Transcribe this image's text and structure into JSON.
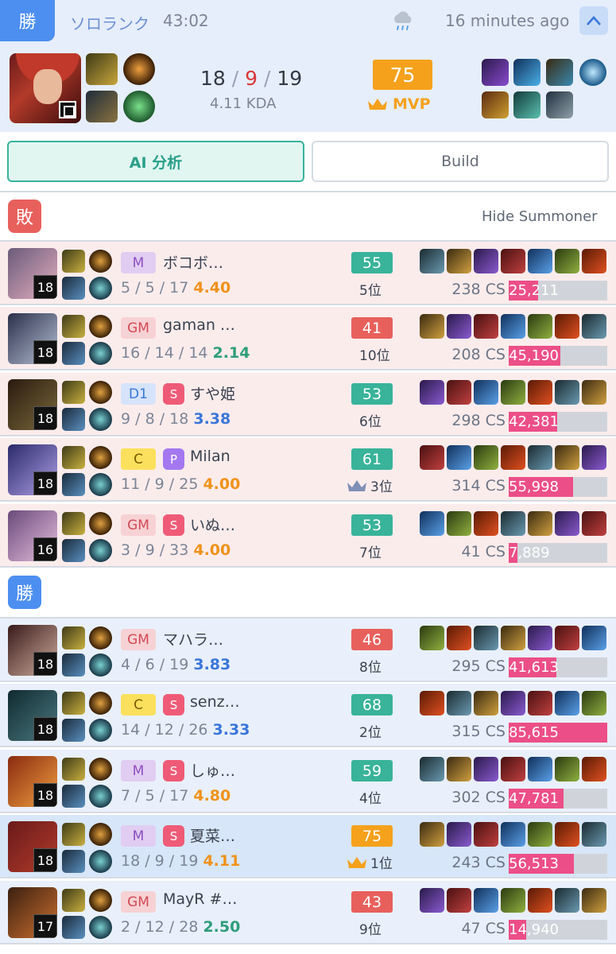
{
  "header": {
    "result": "勝",
    "queue": "ソロランク",
    "duration": "43:02",
    "time_ago": "16 minutes ago"
  },
  "summary": {
    "kills": "18",
    "deaths": "9",
    "assists": "19",
    "kda_ratio": "4.11 KDA",
    "score": "75",
    "mvp_label": "MVP"
  },
  "tabs": {
    "ai": "AI 分析",
    "build": "Build"
  },
  "teams": {
    "lose_label": "敗",
    "win_label": "勝",
    "hide_summoner": "Hide Summoner"
  },
  "colors": {
    "win": "#4d8ff0",
    "lose": "#e8605c",
    "damage": "#ec4f87",
    "score_green": "#39b39a",
    "score_red": "#e8605c",
    "mvp_orange": "#f5a11c"
  },
  "players": [
    {
      "team": "lose",
      "level": "18",
      "rank": "M",
      "sub": "",
      "name": "ボコボ…",
      "k": "5",
      "d": "5",
      "a": "17",
      "ratio": "4.40",
      "ratio_color": "or",
      "score": "55",
      "score_color": "g",
      "place": "5位",
      "crown": false,
      "cs": "238 CS",
      "damage": "25,211",
      "damage_value": 25211
    },
    {
      "team": "lose",
      "level": "18",
      "rank": "GM",
      "sub": "",
      "name": "gaman …",
      "k": "16",
      "d": "14",
      "a": "14",
      "ratio": "2.14",
      "ratio_color": "gr",
      "score": "41",
      "score_color": "r",
      "place": "10位",
      "crown": false,
      "cs": "208 CS",
      "damage": "45,190",
      "damage_value": 45190
    },
    {
      "team": "lose",
      "level": "18",
      "rank": "D1",
      "sub": "S",
      "name": "すや姫",
      "k": "9",
      "d": "8",
      "a": "18",
      "ratio": "3.38",
      "ratio_color": "bl",
      "score": "53",
      "score_color": "g",
      "place": "6位",
      "crown": false,
      "cs": "298 CS",
      "damage": "42,381",
      "damage_value": 42381
    },
    {
      "team": "lose",
      "level": "18",
      "rank": "C",
      "sub": "P",
      "name": "Milan",
      "k": "11",
      "d": "9",
      "a": "25",
      "ratio": "4.00",
      "ratio_color": "or",
      "score": "61",
      "score_color": "g",
      "place": "3位",
      "crown": true,
      "cs": "314 CS",
      "damage": "55,998",
      "damage_value": 55998
    },
    {
      "team": "lose",
      "level": "16",
      "rank": "GM",
      "sub": "S",
      "name": "いぬ…",
      "k": "3",
      "d": "9",
      "a": "33",
      "ratio": "4.00",
      "ratio_color": "or",
      "score": "53",
      "score_color": "g",
      "place": "7位",
      "crown": false,
      "cs": "41 CS",
      "damage": "7,889",
      "damage_value": 7889
    },
    {
      "team": "win",
      "level": "18",
      "rank": "GM",
      "sub": "",
      "name": "マハラ…",
      "k": "4",
      "d": "6",
      "a": "19",
      "ratio": "3.83",
      "ratio_color": "bl",
      "score": "46",
      "score_color": "r",
      "place": "8位",
      "crown": false,
      "cs": "295 CS",
      "damage": "41,613",
      "damage_value": 41613
    },
    {
      "team": "win",
      "level": "18",
      "rank": "C",
      "sub": "S",
      "name": "senz…",
      "k": "14",
      "d": "12",
      "a": "26",
      "ratio": "3.33",
      "ratio_color": "bl",
      "score": "68",
      "score_color": "g",
      "place": "2位",
      "crown": false,
      "cs": "315 CS",
      "damage": "85,615",
      "damage_value": 85615
    },
    {
      "team": "win",
      "level": "18",
      "rank": "M",
      "sub": "S",
      "name": "しゅ…",
      "k": "7",
      "d": "5",
      "a": "17",
      "ratio": "4.80",
      "ratio_color": "or",
      "score": "59",
      "score_color": "g",
      "place": "4位",
      "crown": false,
      "cs": "302 CS",
      "damage": "47,781",
      "damage_value": 47781
    },
    {
      "team": "win",
      "level": "18",
      "rank": "M",
      "sub": "S",
      "name": "夏菜…",
      "k": "18",
      "d": "9",
      "a": "19",
      "ratio": "4.11",
      "ratio_color": "or",
      "score": "75",
      "score_color": "o",
      "place": "1位",
      "crown": true,
      "cs": "243 CS",
      "damage": "56,513",
      "damage_value": 56513,
      "me": true
    },
    {
      "team": "win",
      "level": "17",
      "rank": "GM",
      "sub": "",
      "name": "MayR #…",
      "k": "2",
      "d": "12",
      "a": "28",
      "ratio": "2.50",
      "ratio_color": "gr",
      "score": "43",
      "score_color": "r",
      "place": "9位",
      "crown": false,
      "cs": "47 CS",
      "damage": "14,940",
      "damage_value": 14940
    }
  ],
  "max_damage": 85615
}
